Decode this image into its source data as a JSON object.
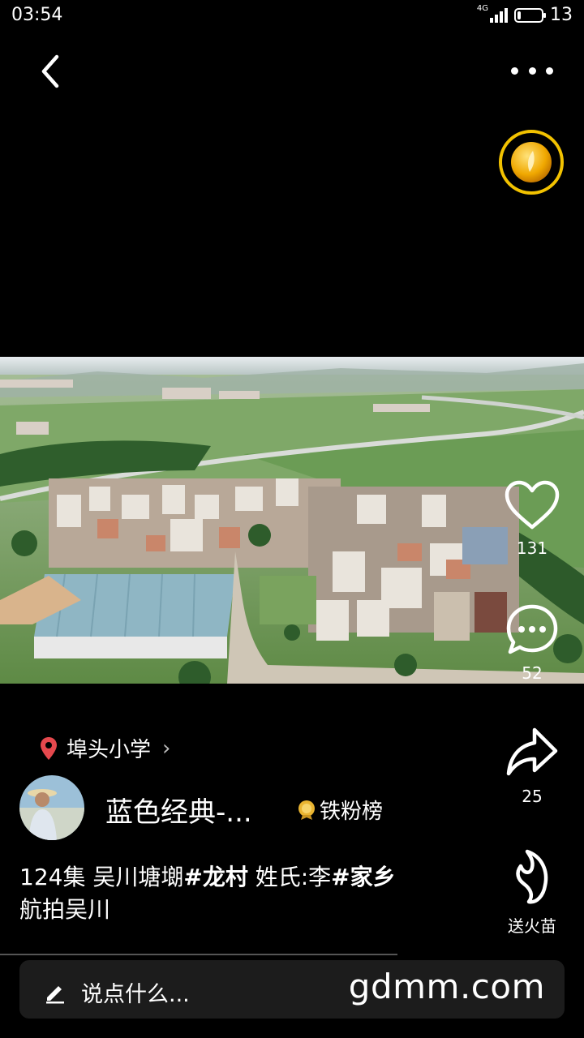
{
  "status_bar": {
    "time": "03:54",
    "network": "4G",
    "battery_level": "13",
    "battery_fraction": 0.13
  },
  "nav": {
    "back_icon": "chevron-left-icon",
    "more_icon": "more-dots-icon"
  },
  "actions": {
    "likes": "131",
    "comments": "52",
    "shares": "25",
    "gift_label": "送火苗"
  },
  "location": {
    "name": "埠头小学"
  },
  "author": {
    "name": "蓝色经典-...",
    "rank_label": "铁粉榜"
  },
  "caption": {
    "part1": "124集 吴川塘㙟",
    "tag1": "#龙村",
    "part2": " 姓氏:李",
    "tag2": "#家乡",
    "line2": "航拍吴川"
  },
  "comment_bar": {
    "placeholder": "说点什么...",
    "watermark": "gdmm.com"
  },
  "colors": {
    "accent_gold": "#f2c200",
    "location_pin": "#e5484d"
  }
}
